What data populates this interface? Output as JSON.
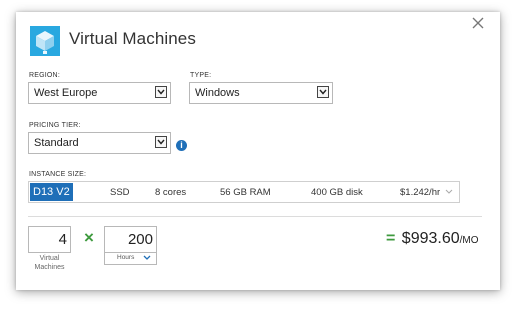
{
  "dialog": {
    "title": "Virtual Machines",
    "icon": "virtual-machine-cube-icon",
    "close_icon": "close-icon"
  },
  "region": {
    "label": "REGION:",
    "value": "West Europe"
  },
  "type": {
    "label": "TYPE:",
    "value": "Windows"
  },
  "pricing_tier": {
    "label": "PRICING TIER:",
    "value": "Standard",
    "info_icon": "info-icon",
    "info_glyph": "i"
  },
  "instance": {
    "label": "INSTANCE SIZE:",
    "size": "D13 V2",
    "storage": "SSD",
    "cores": "8 cores",
    "ram": "56 GB RAM",
    "disk": "400 GB disk",
    "price": "$1.242/hr"
  },
  "calc": {
    "count": "4",
    "count_label_line1": "Virtual",
    "count_label_line2": "Machines",
    "times": "×",
    "hours": "200",
    "hours_label": "Hours",
    "equals": "=",
    "total": "$993.60",
    "per": "/MO"
  },
  "colors": {
    "accent_blue": "#1f6fb8",
    "green": "#3e9a3e",
    "logo_blue": "#29a8e0"
  }
}
